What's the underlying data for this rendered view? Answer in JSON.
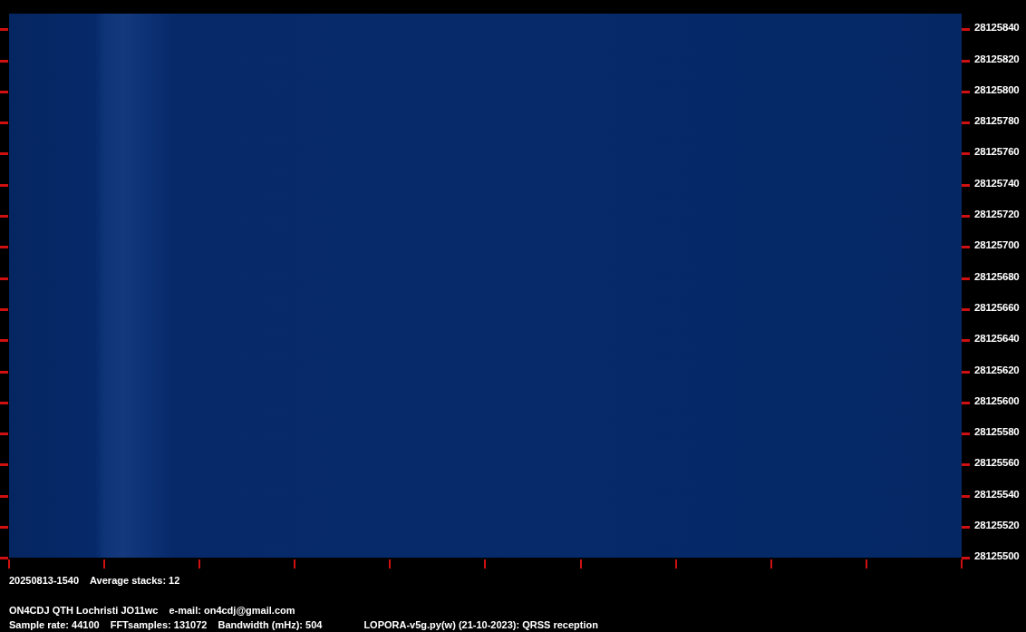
{
  "frequency_labels": [
    "28125840",
    "28125820",
    "28125800",
    "28125780",
    "28125760",
    "28125740",
    "28125720",
    "28125700",
    "28125680",
    "28125660",
    "28125640",
    "28125620",
    "28125600",
    "28125580",
    "28125560",
    "28125540",
    "28125520",
    "28125500"
  ],
  "info_line_1": [
    "20250813-1540",
    "Average stacks: 12"
  ],
  "info_line_2": [
    "ON4CDJ QTH Lochristi JO11wc",
    "e-mail: on4cdj@gmail.com"
  ],
  "info_line_3": [
    "Sample rate: 44100",
    "FFTsamples: 131072",
    "Bandwidth (mHz): 504",
    "LOPORA-v5g.py(w) (21-10-2023): QRSS reception"
  ]
}
